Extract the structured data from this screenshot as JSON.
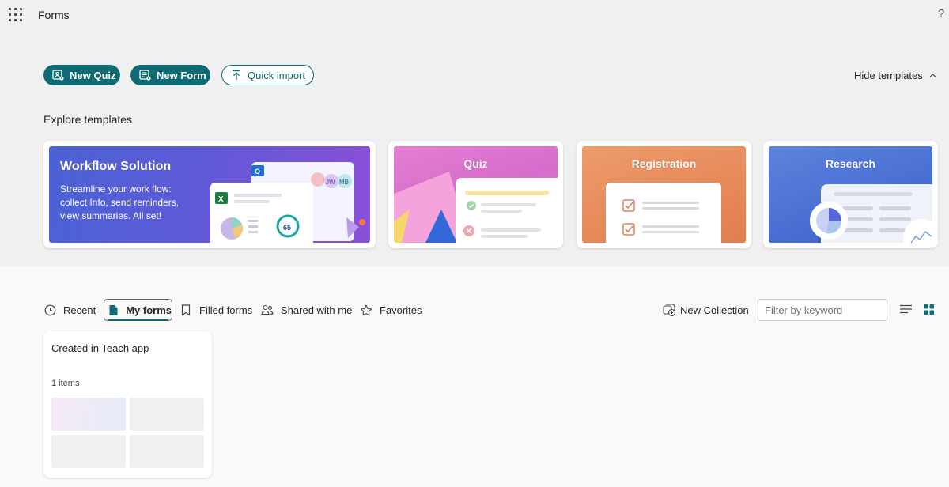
{
  "header": {
    "app_title": "Forms",
    "help_label": "?"
  },
  "actions": {
    "new_quiz": "New Quiz",
    "new_form": "New Form",
    "quick_import": "Quick import",
    "hide_templates": "Hide templates"
  },
  "templates": {
    "section_title": "Explore templates",
    "workflow": {
      "title": "Workflow Solution",
      "description": "Streamline your work flow: collect Info, send reminders, view summaries. All set!",
      "avatars": [
        "JW",
        "MB"
      ],
      "score_value": "65"
    },
    "cards": [
      {
        "label": "Quiz"
      },
      {
        "label": "Registration"
      },
      {
        "label": "Research"
      }
    ]
  },
  "tabs": [
    {
      "label": "Recent",
      "icon": "clock-icon"
    },
    {
      "label": "My forms",
      "icon": "document-icon",
      "selected": true
    },
    {
      "label": "Filled forms",
      "icon": "bookmark-icon"
    },
    {
      "label": "Shared with me",
      "icon": "people-icon"
    },
    {
      "label": "Favorites",
      "icon": "star-icon"
    }
  ],
  "toolbar": {
    "new_collection": "New Collection",
    "filter_placeholder": "Filter by keyword"
  },
  "collection": {
    "title": "Created in Teach app",
    "count": "1 items"
  },
  "colors": {
    "accent": "#0f6b73",
    "top_background": "#f0f0f0",
    "page_background": "#faf9f8"
  }
}
